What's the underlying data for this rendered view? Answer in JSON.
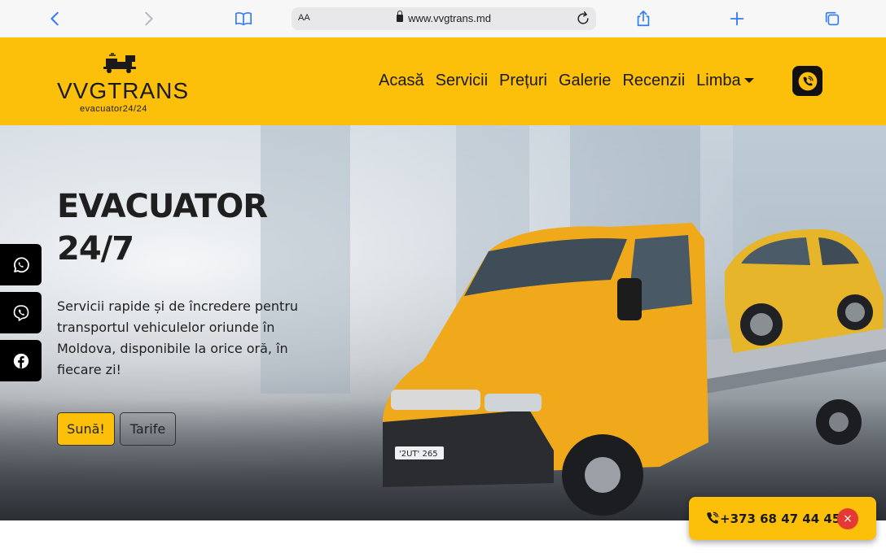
{
  "browser": {
    "text_size_label": "AA",
    "url": "www.vvgtrans.md"
  },
  "logo": {
    "title": "VVGTRANS",
    "subtitle": "evacuator24/24"
  },
  "nav": {
    "items": [
      "Acasă",
      "Servicii",
      "Prețuri",
      "Galerie",
      "Recenzii",
      "Limba"
    ]
  },
  "hero": {
    "title_line1": "EVACUATOR",
    "title_line2": "24/7",
    "description": "Servicii rapide și de încredere pentru transportul vehiculelor oriunde în Moldova, disponibile la orice oră, în fiecare zi!",
    "call_button": "Sună!",
    "rates_button": "Tarife"
  },
  "floating_contact": {
    "phone": "+373 68 47 44 45",
    "close_label": "×"
  },
  "colors": {
    "brand_yellow": "#fcc00b",
    "dark": "#111111",
    "close_red": "#e53935"
  },
  "icons": [
    "back-icon",
    "forward-icon",
    "book-icon",
    "lock-icon",
    "reload-icon",
    "share-icon",
    "plus-icon",
    "tabs-icon",
    "viber-icon",
    "whatsapp-icon",
    "facebook-icon",
    "phone-icon"
  ]
}
